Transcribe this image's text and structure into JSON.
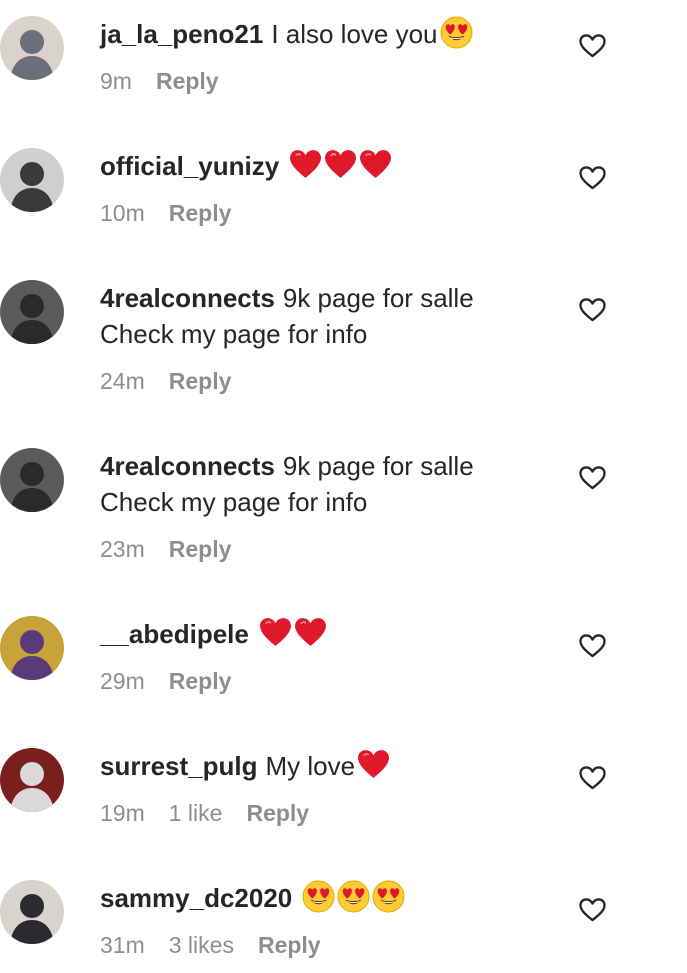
{
  "comments": [
    {
      "username": "ja_la_peno21",
      "text": "I also love you",
      "emoji": [
        "heart-eyes"
      ],
      "time": "9m",
      "likes": "",
      "reply_label": "Reply",
      "avatar": {
        "bg": "#d9d3cc",
        "fg": "#6b6f7c"
      }
    },
    {
      "username": "official_yunizy",
      "text": "",
      "emoji": [
        "red-heart",
        "red-heart",
        "red-heart"
      ],
      "time": "10m",
      "likes": "",
      "reply_label": "Reply",
      "avatar": {
        "bg": "#cfcfcf",
        "fg": "#3a3a3a"
      }
    },
    {
      "username": "4realconnects",
      "text": "9k page for salle\nCheck my page for info",
      "emoji": [],
      "time": "24m",
      "likes": "",
      "reply_label": "Reply",
      "avatar": {
        "bg": "#5b5a5c",
        "fg": "#2a2a2c"
      }
    },
    {
      "username": "4realconnects",
      "text": "9k page for salle\nCheck my page for info",
      "emoji": [],
      "time": "23m",
      "likes": "",
      "reply_label": "Reply",
      "avatar": {
        "bg": "#5b5a5c",
        "fg": "#2a2a2c"
      }
    },
    {
      "username": "__abedipele",
      "text": "",
      "emoji": [
        "red-heart",
        "red-heart"
      ],
      "time": "29m",
      "likes": "",
      "reply_label": "Reply",
      "avatar": {
        "bg": "#c9a23a",
        "fg": "#5a3b7a"
      }
    },
    {
      "username": "surrest_pulg",
      "text": "My love",
      "emoji": [
        "red-heart"
      ],
      "time": "19m",
      "likes": "1 like",
      "reply_label": "Reply",
      "avatar": {
        "bg": "#7a1e1e",
        "fg": "#d9d9d9"
      }
    },
    {
      "username": "sammy_dc2020",
      "text": "",
      "emoji": [
        "heart-eyes",
        "heart-eyes",
        "heart-eyes"
      ],
      "time": "31m",
      "likes": "3 likes",
      "reply_label": "Reply",
      "avatar": {
        "bg": "#d7d3cd",
        "fg": "#2c2c30"
      }
    }
  ],
  "colors": {
    "heart": "#e0192a",
    "face": "#ffcc33",
    "muted": "#8e8e8e",
    "text": "#262626"
  }
}
